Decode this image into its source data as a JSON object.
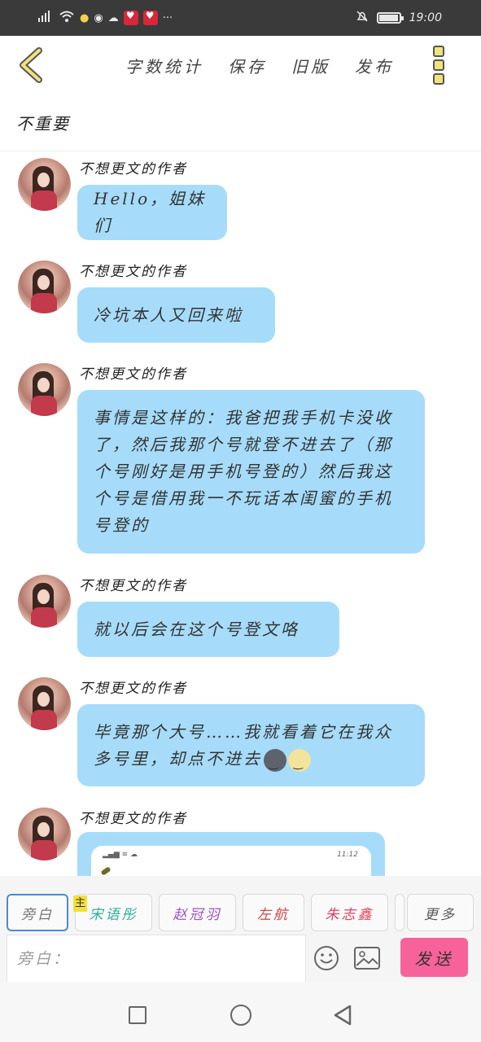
{
  "status_bar": {
    "time": "19:00",
    "battery_level": 0.9
  },
  "toolbar": {
    "word_count_label": "字数统计",
    "save_label": "保存",
    "old_version_label": "旧版",
    "publish_label": "发布"
  },
  "chat": {
    "title": "不重要"
  },
  "messages": [
    {
      "sender": "不想更文的作者",
      "text": "Hello，姐妹们"
    },
    {
      "sender": "不想更文的作者",
      "text": "冷坑本人又回来啦"
    },
    {
      "sender": "不想更文的作者",
      "text": "事情是这样的：我爸把我手机卡没收了，然后我那个号就登不进去了（那个号刚好是用手机号登的）然后我这个号是借用我一不玩话本闺蜜的手机号登的"
    },
    {
      "sender": "不想更文的作者",
      "text": "就以后会在这个号登文咯"
    },
    {
      "sender": "不想更文的作者",
      "text": "毕竟那个大号……我就看着它在我众多号里，却点不进去"
    },
    {
      "sender": "不想更文的作者",
      "screenshot_time": "11:12"
    }
  ],
  "composer": {
    "characters": [
      "旁白",
      "宋语彤",
      "赵冠羽",
      "左航",
      "朱志鑫"
    ],
    "main_badge": "主",
    "more_label": "更多",
    "input_placeholder": "旁白：",
    "send_label": "发送"
  },
  "colors": {
    "bubble": "#a6dcfa",
    "send_button": "#f7629a",
    "accent": "#f3e27a"
  }
}
